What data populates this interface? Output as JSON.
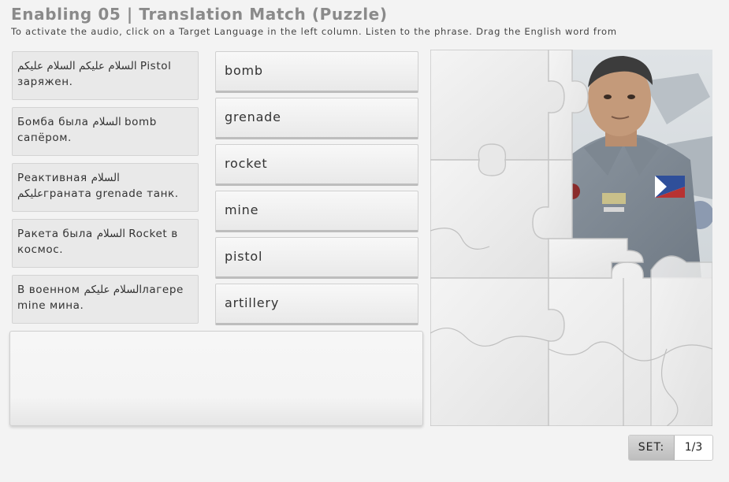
{
  "header": {
    "title": "Enabling 05 | Translation Match (Puzzle)",
    "instructions": "To activate the audio, click on a Target Language in the left column. Listen to the phrase. Drag the English word from"
  },
  "phrases": [
    "السلام عليكم السلام عليكم Pistol заряжен.",
    "Бомба была السلام bomb сапёром.",
    "Реактивная السلام عليكمграната grenade танк.",
    "Ракета была السلام Rocket в космос.",
    "В военном السلام عليكمлагере mine мина."
  ],
  "words": [
    "bomb",
    "grenade",
    "rocket",
    "mine",
    "pistol",
    "artillery"
  ],
  "set": {
    "label": "SET:",
    "value": "1/3"
  }
}
